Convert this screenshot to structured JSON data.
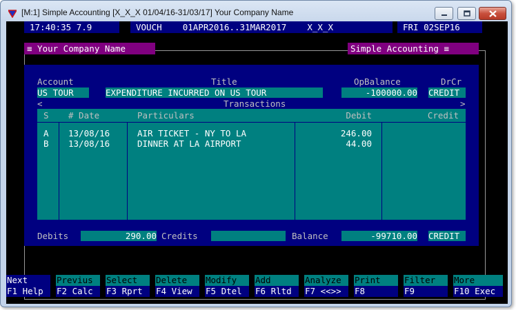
{
  "window": {
    "title": "[M:1]  Simple Accounting  [X_X_X  01/04/16-31/03/17]  Your Company Name"
  },
  "statusbar": {
    "clock": "17:40:35 7.9",
    "module": "VOUCH    01APR2016..31MAR2017    X_X_X",
    "date": "FRI 02SEP16"
  },
  "tags": {
    "company": "≡ Your Company Name",
    "app": "Simple Accounting ≡"
  },
  "account": {
    "labels": {
      "account": "Account",
      "title": "Title",
      "opbalance": "OpBalance",
      "drcr": "DrCr"
    },
    "code": "US TOUR",
    "title": "EXPENDITURE INCURRED ON US TOUR",
    "opbalance": "-100000.00",
    "drcr": "CREDIT"
  },
  "transactions": {
    "nav_left": "<",
    "nav_right": ">",
    "caption": "Transactions",
    "columns": {
      "s": "S",
      "num_date": "# Date",
      "particulars": "Particulars",
      "debit": "Debit",
      "credit": "Credit"
    },
    "rows": [
      {
        "s": "A",
        "date": "13/08/16",
        "particulars": "AIR TICKET - NY TO LA",
        "debit": "246.00",
        "credit": ""
      },
      {
        "s": "B",
        "date": "13/08/16",
        "particulars": "DINNER AT LA AIRPORT",
        "debit": "44.00",
        "credit": ""
      }
    ]
  },
  "totals": {
    "debits_label": "Debits",
    "debits": "290.00",
    "credits_label": "Credits",
    "credits": "",
    "balance_label": "Balance",
    "balance": "-99710.00",
    "balance_drcr": "CREDIT"
  },
  "fkeys": [
    {
      "top": "Next",
      "bottom": "F1 Help"
    },
    {
      "top": "Previus",
      "bottom": "F2 Calc"
    },
    {
      "top": "Select",
      "bottom": "F3 Rprt"
    },
    {
      "top": "Delete",
      "bottom": "F4 View"
    },
    {
      "top": "Modify",
      "bottom": "F5 Dtel"
    },
    {
      "top": "Add",
      "bottom": "F6 Rltd"
    },
    {
      "top": "Analyze",
      "bottom": "F7 <<>>"
    },
    {
      "top": "Print",
      "bottom": "F8"
    },
    {
      "top": "Filter",
      "bottom": "F9"
    },
    {
      "top": "More",
      "bottom": "F10 Exec"
    }
  ],
  "colors": {
    "navy": "#000080",
    "teal": "#008080",
    "purple": "#800080",
    "console_bg": "#000000"
  },
  "icons": {
    "app": "triangle-app-icon",
    "minimize": "minimize-icon",
    "maximize": "maximize-icon",
    "close": "close-icon"
  }
}
